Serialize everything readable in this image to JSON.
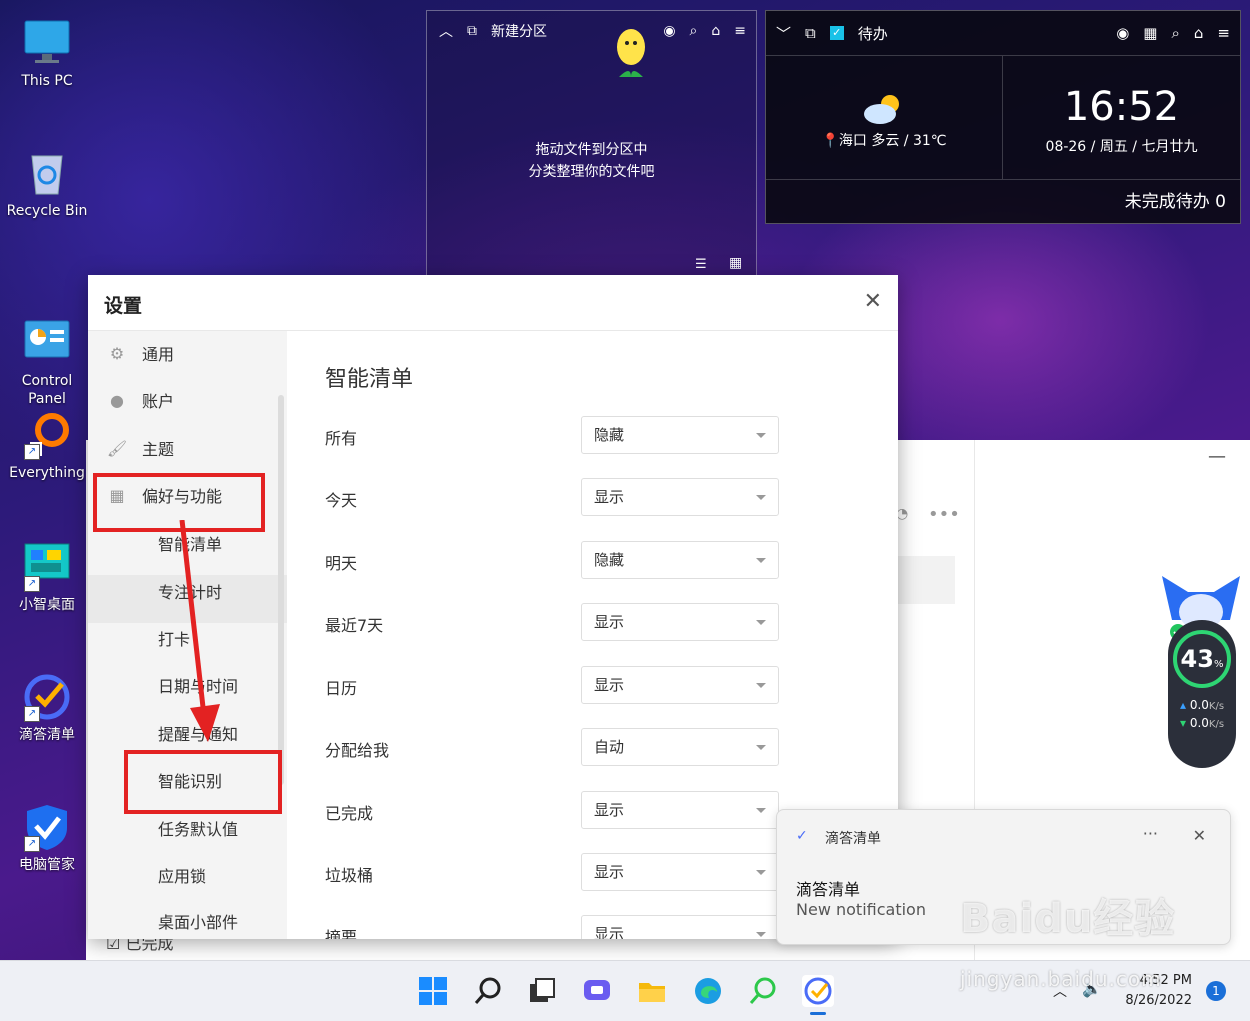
{
  "desktop_icons": [
    {
      "label": "This PC"
    },
    {
      "label": "Recycle Bin"
    },
    {
      "label": "Control\nPanel"
    },
    {
      "label": "Everything"
    },
    {
      "label": "小智桌面"
    },
    {
      "label": "滴答清单"
    },
    {
      "label": "电脑管家"
    }
  ],
  "fence_left": {
    "title": "新建分区",
    "hint_line1": "拖动文件到分区中",
    "hint_line2": "分类整理你的文件吧"
  },
  "fence_right": {
    "title": "待办",
    "weather": "海口 多云 / 31℃",
    "time": "16:52",
    "date": "08-26 / 周五 / 七月廿九",
    "todo_status": "未完成待办 0"
  },
  "settings": {
    "title": "设置",
    "sidebar": {
      "items": [
        "通用",
        "账户",
        "主题",
        "偏好与功能"
      ],
      "subitems": [
        "智能清单",
        "专注计时",
        "打卡",
        "日期与时间",
        "提醒与通知",
        "智能识别",
        "任务默认值",
        "应用锁",
        "桌面小部件"
      ]
    },
    "main": {
      "title": "智能清单",
      "rows": [
        {
          "label": "所有",
          "value": "隐藏"
        },
        {
          "label": "今天",
          "value": "显示"
        },
        {
          "label": "明天",
          "value": "隐藏"
        },
        {
          "label": "最近7天",
          "value": "显示"
        },
        {
          "label": "日历",
          "value": "显示"
        },
        {
          "label": "分配给我",
          "value": "自动"
        },
        {
          "label": "已完成",
          "value": "显示"
        },
        {
          "label": "垃圾桶",
          "value": "显示"
        },
        {
          "label": "摘要",
          "value": "显示"
        }
      ]
    }
  },
  "bg_app": {
    "completed_label": "已完成"
  },
  "notification": {
    "app_name": "滴答清单",
    "title": "滴答清单",
    "body": "New notification"
  },
  "speed_widget": {
    "percent": "43",
    "percent_unit": "%",
    "up": "0.0",
    "down": "0.0",
    "unit": "K/s"
  },
  "taskbar": {
    "time": "4:52 PM",
    "date": "8/26/2022",
    "badge": "1"
  },
  "watermark": {
    "text": "Baidu经验",
    "sub": "jingyan.baidu.com"
  }
}
